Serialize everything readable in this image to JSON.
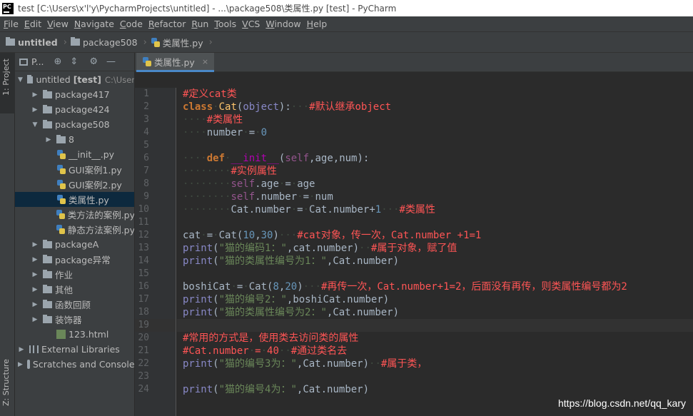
{
  "window": {
    "title": "test [C:\\Users\\x'l'y\\PycharmProjects\\untitled] - ...\\package508\\类属性.py [test] - PyCharm",
    "logo_text": "PC"
  },
  "menu": [
    {
      "label": "File",
      "u": "F",
      "rest": "ile"
    },
    {
      "label": "Edit",
      "u": "E",
      "rest": "dit"
    },
    {
      "label": "View",
      "u": "V",
      "rest": "iew"
    },
    {
      "label": "Navigate",
      "u": "N",
      "rest": "avigate"
    },
    {
      "label": "Code",
      "u": "C",
      "rest": "ode"
    },
    {
      "label": "Refactor",
      "u": "R",
      "rest": "efactor"
    },
    {
      "label": "Run",
      "u": "R",
      "rest": "un",
      "first": "R"
    },
    {
      "label": "Tools",
      "u": "T",
      "rest": "ools"
    },
    {
      "label": "VCS",
      "u": "V",
      "rest": "CS"
    },
    {
      "label": "Window",
      "u": "W",
      "rest": "indow"
    },
    {
      "label": "Help",
      "u": "H",
      "rest": "elp"
    }
  ],
  "breadcrumb": [
    "untitled",
    "package508",
    "类属性.py"
  ],
  "left_tabs": {
    "project": "1: Project",
    "structure": "Z: Structure"
  },
  "project_panel": {
    "header": "P...",
    "icons": [
      "target-icon",
      "collapse-icon",
      "gear-icon",
      "minimize-icon"
    ]
  },
  "tree": [
    {
      "indent": 0,
      "arrow": "▼",
      "icon": "folder",
      "label": "untitled",
      "extra": "[test]",
      "dim": "C:\\User"
    },
    {
      "indent": 1,
      "arrow": "▶",
      "icon": "folder",
      "label": "package417"
    },
    {
      "indent": 1,
      "arrow": "▶",
      "icon": "folder",
      "label": "package424"
    },
    {
      "indent": 1,
      "arrow": "▼",
      "icon": "folder",
      "label": "package508"
    },
    {
      "indent": 2,
      "arrow": "▶",
      "icon": "folder",
      "label": "8"
    },
    {
      "indent": 2,
      "arrow": "",
      "icon": "py",
      "label": "__init__.py"
    },
    {
      "indent": 2,
      "arrow": "",
      "icon": "py",
      "label": "GUI案例1.py"
    },
    {
      "indent": 2,
      "arrow": "",
      "icon": "py",
      "label": "GUI案例2.py"
    },
    {
      "indent": 2,
      "arrow": "",
      "icon": "py",
      "label": "类属性.py",
      "selected": true
    },
    {
      "indent": 2,
      "arrow": "",
      "icon": "py",
      "label": "类方法的案例.py"
    },
    {
      "indent": 2,
      "arrow": "",
      "icon": "py",
      "label": "静态方法案例.py"
    },
    {
      "indent": 1,
      "arrow": "▶",
      "icon": "folder",
      "label": "packageA"
    },
    {
      "indent": 1,
      "arrow": "▶",
      "icon": "folder",
      "label": "package异常"
    },
    {
      "indent": 1,
      "arrow": "▶",
      "icon": "folder",
      "label": "作业"
    },
    {
      "indent": 1,
      "arrow": "▶",
      "icon": "folder",
      "label": "其他"
    },
    {
      "indent": 1,
      "arrow": "▶",
      "icon": "folder",
      "label": "函数回顾"
    },
    {
      "indent": 1,
      "arrow": "▶",
      "icon": "folder",
      "label": "装饰器"
    },
    {
      "indent": 2,
      "arrow": "",
      "icon": "html",
      "label": "123.html"
    },
    {
      "indent": 0,
      "arrow": "▶",
      "icon": "lib",
      "label": "External Libraries"
    },
    {
      "indent": 0,
      "arrow": "▶",
      "icon": "scratch",
      "label": "Scratches and Consoles"
    }
  ],
  "editor_tab": {
    "label": "类属性.py",
    "close": "×"
  },
  "current_line": 19,
  "code": [
    [
      [
        "c",
        "#定义cat类"
      ]
    ],
    [
      [
        "k",
        "class"
      ],
      [
        "w",
        "·"
      ],
      [
        "fn",
        "Cat"
      ],
      [
        "t",
        "("
      ],
      [
        "b",
        "object"
      ],
      [
        "t",
        "):"
      ],
      [
        "w",
        "···"
      ],
      [
        "c",
        "#默认继承object"
      ]
    ],
    [
      [
        "w",
        "····"
      ],
      [
        "c",
        "#类属性"
      ]
    ],
    [
      [
        "w",
        "····"
      ],
      [
        "t",
        "number"
      ],
      [
        "w",
        "·"
      ],
      [
        "t",
        "="
      ],
      [
        "w",
        "·"
      ],
      [
        "n",
        "0"
      ]
    ],
    [],
    [
      [
        "w",
        "····"
      ],
      [
        "k",
        "def"
      ],
      [
        "w",
        "·"
      ],
      [
        "mg",
        "__init__"
      ],
      [
        "t",
        "("
      ],
      [
        "sf",
        "self"
      ],
      [
        "t",
        ",age,num):"
      ]
    ],
    [
      [
        "w",
        "········"
      ],
      [
        "c",
        "#实例属性"
      ]
    ],
    [
      [
        "w",
        "········"
      ],
      [
        "sf",
        "self"
      ],
      [
        "t",
        ".age"
      ],
      [
        "w",
        "·"
      ],
      [
        "t",
        "="
      ],
      [
        "w",
        "·"
      ],
      [
        "t",
        "age"
      ]
    ],
    [
      [
        "w",
        "········"
      ],
      [
        "sf",
        "self"
      ],
      [
        "t",
        ".number"
      ],
      [
        "w",
        "·"
      ],
      [
        "t",
        "="
      ],
      [
        "w",
        "·"
      ],
      [
        "t",
        "num"
      ]
    ],
    [
      [
        "w",
        "········"
      ],
      [
        "t",
        "Cat.number"
      ],
      [
        "w",
        "·"
      ],
      [
        "t",
        "="
      ],
      [
        "w",
        "·"
      ],
      [
        "t",
        "Cat.number+"
      ],
      [
        "n",
        "1"
      ],
      [
        "w",
        "···"
      ],
      [
        "c",
        "#类属性"
      ]
    ],
    [],
    [
      [
        "t",
        "cat"
      ],
      [
        "w",
        "·"
      ],
      [
        "t",
        "="
      ],
      [
        "w",
        "·"
      ],
      [
        "t",
        "Cat("
      ],
      [
        "n",
        "10"
      ],
      [
        "t",
        ","
      ],
      [
        "n",
        "30"
      ],
      [
        "t",
        ")"
      ],
      [
        "w",
        "···"
      ],
      [
        "c",
        "#cat对象，传一次，Cat.number +1=1"
      ]
    ],
    [
      [
        "b",
        "print"
      ],
      [
        "t",
        "("
      ],
      [
        "s",
        "\"猫的编码1：\""
      ],
      [
        "t",
        ",cat.number)"
      ],
      [
        "w",
        "··"
      ],
      [
        "c",
        "#属于对象，赋了值"
      ]
    ],
    [
      [
        "b",
        "print"
      ],
      [
        "t",
        "("
      ],
      [
        "s",
        "\"猫的类属性编号为1：\""
      ],
      [
        "t",
        ",Cat.number)"
      ]
    ],
    [],
    [
      [
        "t",
        "boshiCat"
      ],
      [
        "w",
        "·"
      ],
      [
        "t",
        "="
      ],
      [
        "w",
        "·"
      ],
      [
        "t",
        "Cat("
      ],
      [
        "n",
        "8"
      ],
      [
        "t",
        ","
      ],
      [
        "n",
        "20"
      ],
      [
        "t",
        ")"
      ],
      [
        "w",
        "···"
      ],
      [
        "c",
        "#再传一次，Cat.number+1=2，后面没有再传，则类属性编号都为2"
      ]
    ],
    [
      [
        "b",
        "print"
      ],
      [
        "t",
        "("
      ],
      [
        "s",
        "\"猫的编号2：\""
      ],
      [
        "t",
        ",boshiCat.number)"
      ]
    ],
    [
      [
        "b",
        "print"
      ],
      [
        "t",
        "("
      ],
      [
        "s",
        "\"猫的类属性编号为2：\""
      ],
      [
        "t",
        ",Cat.number)"
      ]
    ],
    [],
    [
      [
        "c",
        "#常用的方式是，使用类去访问类的属性"
      ]
    ],
    [
      [
        "c",
        "#Cat.number"
      ],
      [
        "w",
        "·"
      ],
      [
        "c",
        "="
      ],
      [
        "w",
        "·"
      ],
      [
        "c",
        "40"
      ],
      [
        "w",
        "··"
      ],
      [
        "c",
        "#通过类名去"
      ]
    ],
    [
      [
        "b",
        "print"
      ],
      [
        "t",
        "("
      ],
      [
        "s",
        "\"猫的编号3为：\""
      ],
      [
        "t",
        ",Cat.number)"
      ],
      [
        "w",
        "··"
      ],
      [
        "c",
        "#属于类，"
      ]
    ],
    [],
    [
      [
        "b",
        "print"
      ],
      [
        "t",
        "("
      ],
      [
        "s",
        "\"猫的编号4为：\""
      ],
      [
        "t",
        ",Cat.number)"
      ]
    ]
  ],
  "watermark": "https://blog.csdn.net/qq_kary",
  "colors": {
    "keyword": "#cc7832",
    "comment": "#ff5555",
    "string": "#6a8759",
    "number": "#6897bb",
    "builtin": "#8888c6",
    "self": "#94558d",
    "selection": "#0d293e",
    "tab_underline": "#4a88c7"
  }
}
